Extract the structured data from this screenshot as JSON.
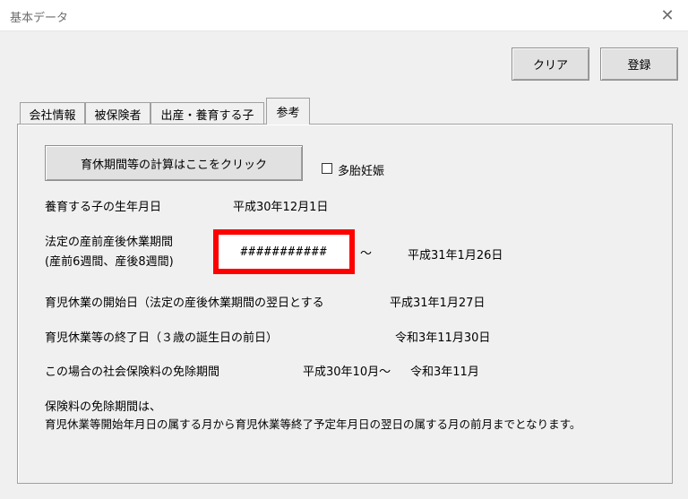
{
  "window": {
    "title": "基本データ",
    "close_glyph": "✕"
  },
  "toolbar": {
    "clear_label": "クリア",
    "register_label": "登録"
  },
  "tabs": [
    {
      "label": "会社情報"
    },
    {
      "label": "被保険者"
    },
    {
      "label": "出産・養育する子"
    },
    {
      "label": "参考"
    }
  ],
  "reference": {
    "calc_button_label": "育休期間等の計算はここをクリック",
    "multiple_pregnancy_label": "多胎妊娠",
    "child_birth_label": "養育する子の生年月日",
    "child_birth_value": "平成30年12月1日",
    "maternity_label_line1": "法定の産前産後休業期間",
    "maternity_label_line2": "(産前6週間、産後8週間)",
    "maternity_start_value": "###########",
    "range_separator": "～",
    "maternity_end_value": "平成31年1月26日",
    "childcare_start_label": "育児休業の開始日（法定の産後休業期間の翌日とする",
    "childcare_start_value": "平成31年1月27日",
    "childcare_end_label": "育児休業等の終了日（３歳の誕生日の前日）",
    "childcare_end_value": "令和3年11月30日",
    "exemption_label": "この場合の社会保険料の免除期間",
    "exemption_start": "平成30年10月～",
    "exemption_end": "令和3年11月",
    "note_line1": "保険料の免除期間は、",
    "note_line2": "育児休業等開始年月日の属する月から育児休業等終了予定年月日の翌日の属する月の前月までとなります。"
  },
  "colors": {
    "highlight_border": "#ff0000"
  }
}
